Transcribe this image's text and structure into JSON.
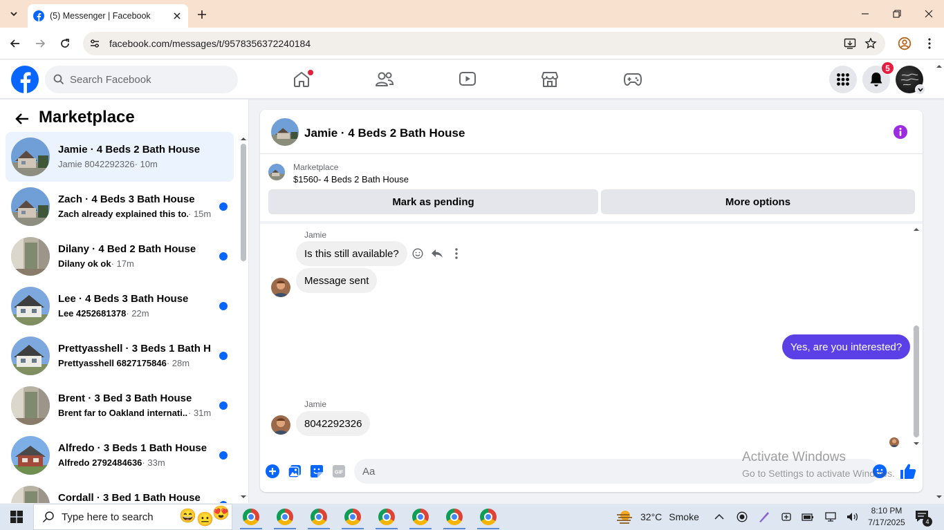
{
  "browser": {
    "tab_title": "(5) Messenger | Facebook",
    "url": "facebook.com/messages/t/9578356372240184"
  },
  "fb": {
    "search_placeholder": "Search Facebook",
    "notification_count": "5"
  },
  "left_pane": {
    "title": "Marketplace",
    "conversations": [
      {
        "name": "Jamie · 4 Beds 2 Bath House",
        "preview": "Jamie 8042292326",
        "time": "· 10m",
        "unread": false,
        "active": true,
        "thumb": "house-blue-sky"
      },
      {
        "name": "Zach · 4 Beds 3 Bath House",
        "preview": "Zach already explained this to...",
        "time": "· 15m",
        "unread": true,
        "active": false,
        "thumb": "house-blue-sky"
      },
      {
        "name": "Dilany · 4 Bed 2 Bath House",
        "preview": "Dilany ok ok",
        "time": "· 17m",
        "unread": true,
        "active": false,
        "thumb": "interior-room"
      },
      {
        "name": "Lee · 4 Beds 3 Bath House",
        "preview": "Lee 4252681378",
        "time": "· 22m",
        "unread": true,
        "active": false,
        "thumb": "house-white"
      },
      {
        "name": "Prettyasshell · 3 Beds 1 Bath H...",
        "preview": "Prettyasshell 6827175846",
        "time": "· 28m",
        "unread": true,
        "active": false,
        "thumb": "house-white"
      },
      {
        "name": "Brent · 3 Bed 3 Bath House",
        "preview": "Brent far to Oakland internati...",
        "time": "· 31m",
        "unread": true,
        "active": false,
        "thumb": "interior-room"
      },
      {
        "name": "Alfredo · 3 Beds 1 Bath House",
        "preview": "Alfredo 2792484636",
        "time": "· 33m",
        "unread": true,
        "active": false,
        "thumb": "house-brick"
      },
      {
        "name": "Cordall · 3 Bed 1 Bath House",
        "preview": "",
        "time": "",
        "unread": true,
        "active": false,
        "thumb": "interior-room"
      }
    ]
  },
  "chat": {
    "title": "Jamie · 4 Beds 2 Bath House",
    "listing_label": "Marketplace",
    "listing_price": "$1560- 4 Beds 2 Bath House",
    "mark_pending": "Mark as pending",
    "more_options": "More options",
    "messages": {
      "sender1": "Jamie",
      "m1": "Is this still available?",
      "m2": "Message sent",
      "m3": "Yes, are you interested?",
      "sender2": "Jamie",
      "m4": "8042292326"
    },
    "composer_placeholder": "Aa"
  },
  "watermark": {
    "line1": "Activate Windows",
    "line2": "Go to Settings to activate Windows."
  },
  "taskbar": {
    "search_placeholder": "Type here to search",
    "temperature": "32°C",
    "weather": "Smoke",
    "time": "8:10 PM",
    "date": "7/17/2025",
    "notification_count": "4"
  },
  "colors": {
    "fb_blue": "#0866ff",
    "outgoing_bubble": "#5b40e8",
    "badge_red": "#e41e3f",
    "tab_bar": "#f9e1cf"
  }
}
